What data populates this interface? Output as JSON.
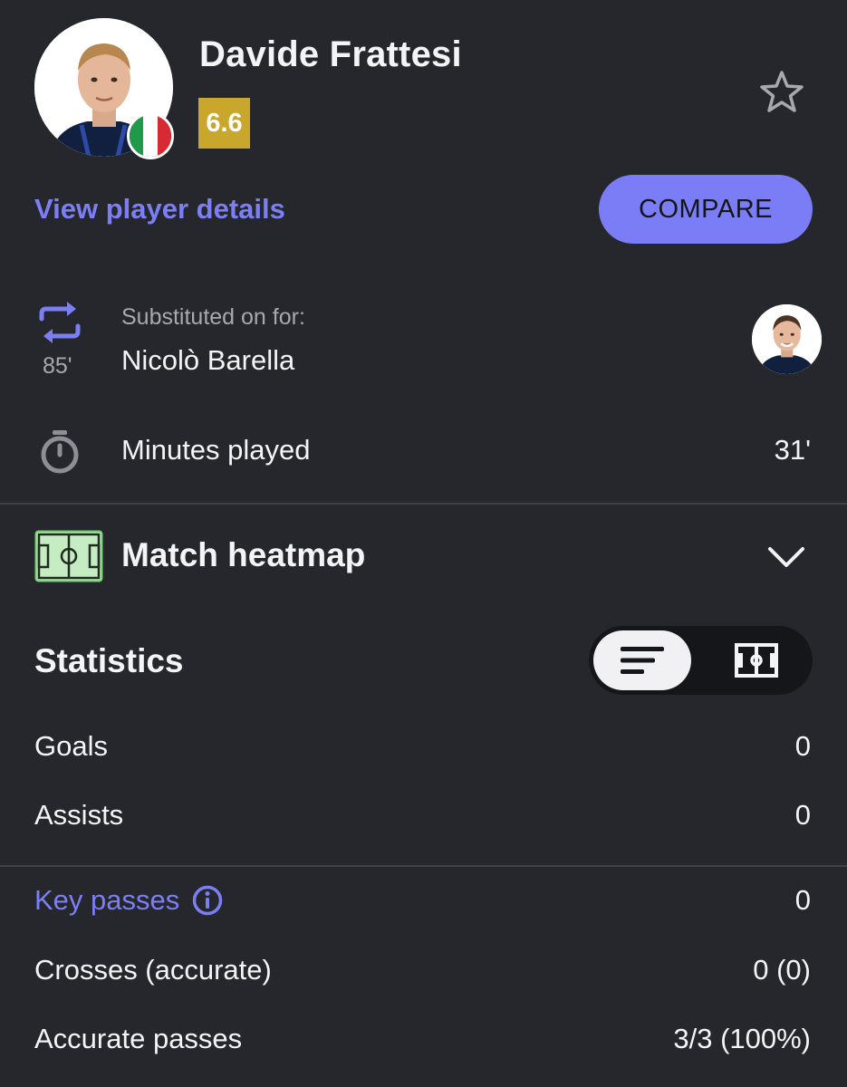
{
  "player": {
    "name": "Davide Frattesi",
    "rating": "6.6",
    "rating_color": "#c9a72c",
    "nationality_flag": "italy-flag",
    "favorite_icon": "star-outline-icon"
  },
  "actions": {
    "details_link": "View player details",
    "compare_button": "COMPARE",
    "accent_color": "#7a7df5"
  },
  "substitution": {
    "icon": "substitution-arrows-icon",
    "minute": "85'",
    "label": "Substituted on for:",
    "player_name": "Nicolò Barella"
  },
  "minutes": {
    "icon": "stopwatch-icon",
    "label": "Minutes played",
    "value": "31'"
  },
  "heatmap": {
    "icon": "pitch-icon",
    "title": "Match heatmap",
    "expand_icon": "chevron-down-icon"
  },
  "statistics": {
    "title": "Statistics",
    "toggle_options": [
      "list-view-icon",
      "pitch-view-icon"
    ],
    "selected_view": "list-view-icon",
    "rows": [
      {
        "label": "Goals",
        "value": "0"
      },
      {
        "label": "Assists",
        "value": "0"
      }
    ],
    "key_passes": {
      "label": "Key passes",
      "value": "0",
      "info_icon": "info-icon"
    },
    "rows2": [
      {
        "label": "Crosses (accurate)",
        "value": "0 (0)"
      },
      {
        "label": "Accurate passes",
        "value": "3/3 (100%)"
      }
    ]
  }
}
